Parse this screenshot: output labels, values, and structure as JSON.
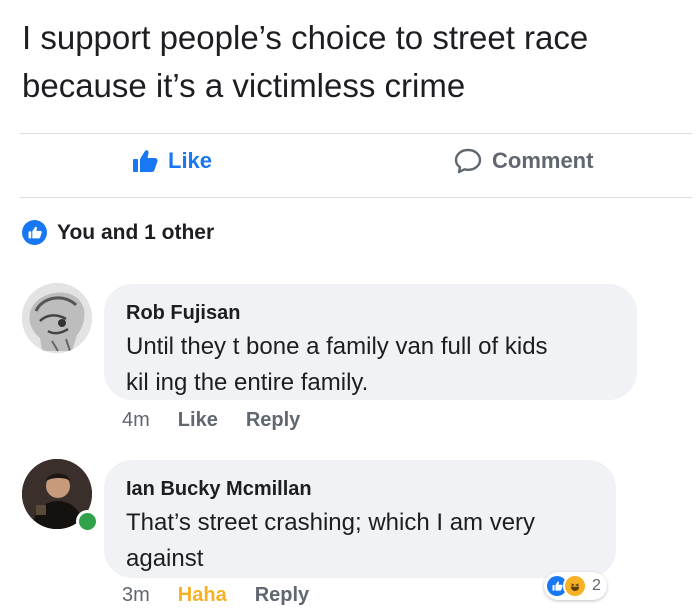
{
  "post": {
    "line1": "I support people’s choice to street race",
    "line2": "because it’s a victimless crime"
  },
  "actions": {
    "like_label": "Like",
    "comment_label": "Comment"
  },
  "reactions": {
    "summary": "You and 1 other"
  },
  "comments": [
    {
      "author": "Rob Fujisan",
      "line1": "Until they t bone a family van full of kids",
      "line2": "kil ing the entire family.",
      "time": "4m",
      "like_label": "Like",
      "reply_label": "Reply"
    },
    {
      "author": "Ian Bucky Mcmillan",
      "line1": "That’s street crashing; which I am very",
      "line2": "against",
      "time": "3m",
      "reaction_label": "Haha",
      "reply_label": "Reply",
      "reaction_count": "2"
    }
  ],
  "colors": {
    "brand_blue": "#1877f2",
    "haha_yellow": "#f7b125",
    "online_green": "#31a24c",
    "bubble_bg": "#f0f2f5",
    "meta_gray": "#606770"
  }
}
